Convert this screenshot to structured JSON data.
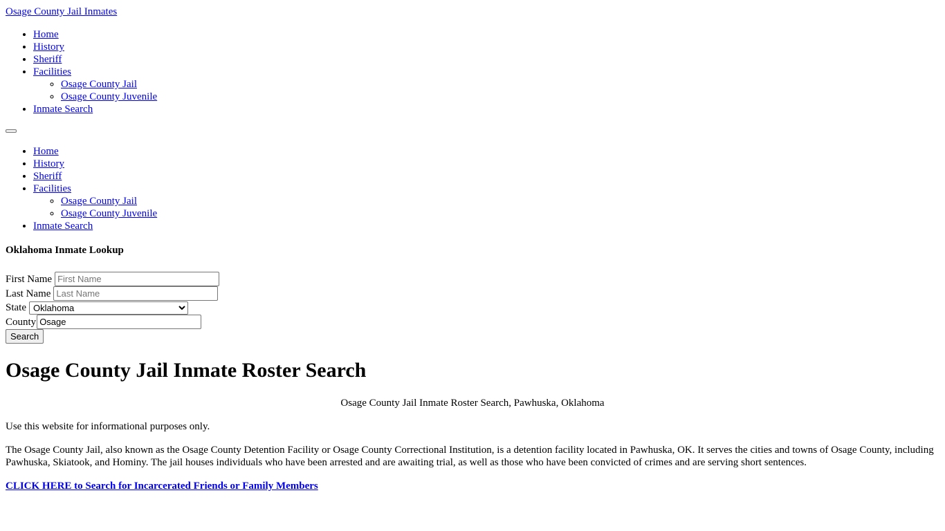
{
  "site": {
    "title": "Osage County Jail Inmates"
  },
  "menu": [
    {
      "label": "Home"
    },
    {
      "label": "History"
    },
    {
      "label": "Sheriff"
    },
    {
      "label": "Facilities",
      "children": [
        {
          "label": "Osage County Jail"
        },
        {
          "label": "Osage County Juvenile"
        }
      ]
    },
    {
      "label": "Inmate Search"
    }
  ],
  "lookup": {
    "title": "Oklahoma Inmate Lookup",
    "first_name_label": "First Name",
    "first_name_placeholder": "First Name",
    "last_name_label": "Last Name",
    "last_name_placeholder": "Last Name",
    "state_label": "State",
    "state_value": "Oklahoma",
    "county_label": "County",
    "county_value": "Osage",
    "search_label": "Search"
  },
  "main": {
    "heading": "Osage County Jail Inmate Roster Search",
    "image_alt": "Osage County Jail Inmate Roster Search, Pawhuska, Oklahoma",
    "disclaimer": "Use this website for informational purposes only.",
    "intro": "The Osage County Jail, also known as the Osage County Detention Facility or Osage County Correctional Institution, is a detention facility located in Pawhuska, OK. It serves the cities and towns of Osage County, including Pawhuska, Skiatook, and Hominy. The jail houses individuals who have been arrested and are awaiting trial, as well as those who have been convicted of crimes and are serving short sentences.",
    "cta": "CLICK HERE to Search for Incarcerated Friends or Family Members"
  },
  "colors": {
    "link": "#0000ee",
    "text": "#000000",
    "background": "#ffffff"
  }
}
